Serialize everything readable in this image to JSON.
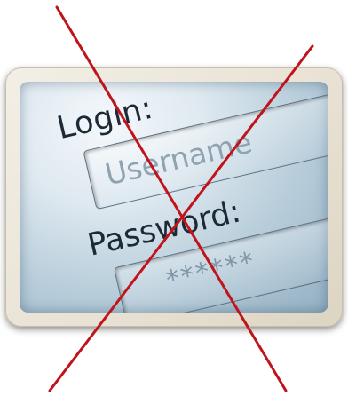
{
  "login_form": {
    "login_label": "Login:",
    "username_placeholder": "Username",
    "password_label": "Password:",
    "password_value": "******"
  },
  "colors": {
    "cross": "#c0141c",
    "frame": "#ece6da",
    "screen": "#b9cedb",
    "text": "#1c2a36"
  },
  "icon": "cross-out-icon"
}
